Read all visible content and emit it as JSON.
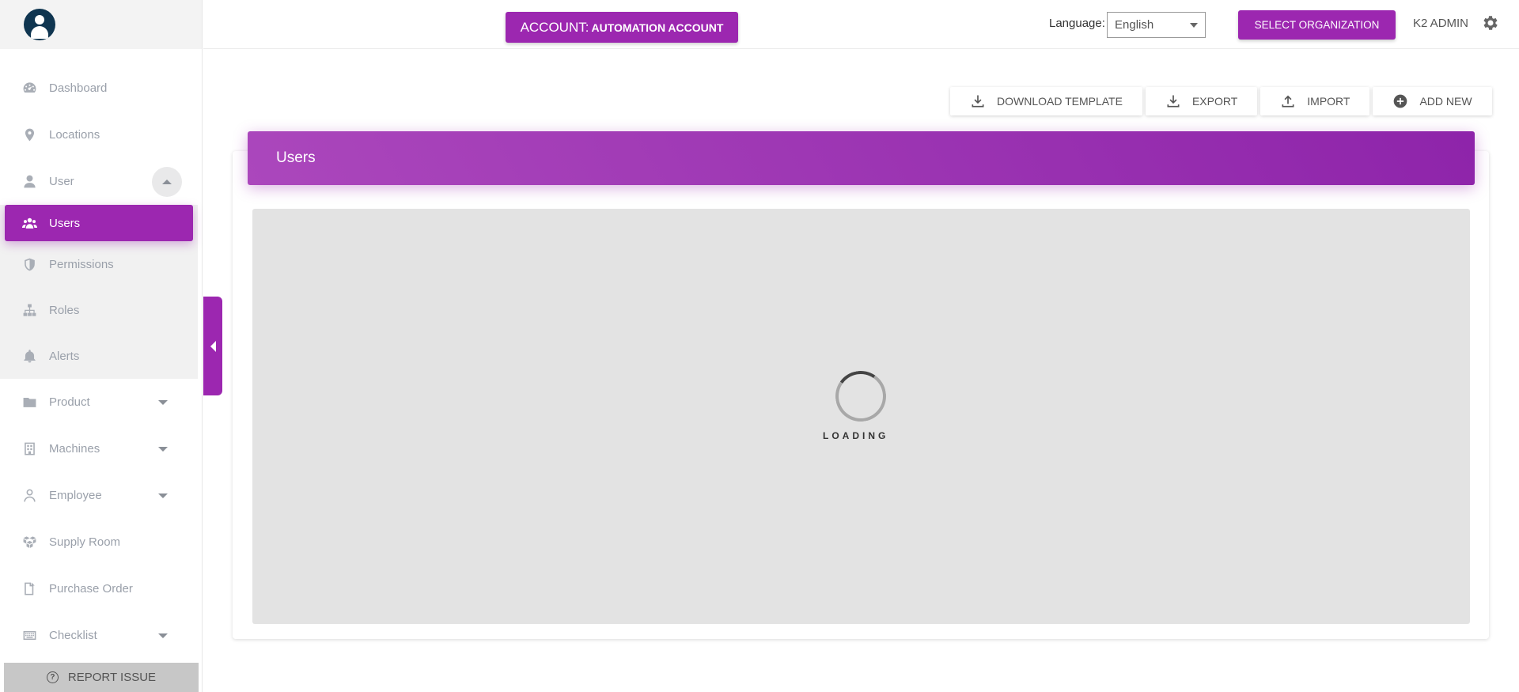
{
  "sidebar": {
    "items": [
      {
        "label": "Dashboard",
        "icon": "dashboard-gauge-icon"
      },
      {
        "label": "Locations",
        "icon": "map-pin-icon"
      },
      {
        "label": "User",
        "icon": "person-icon"
      },
      {
        "label": "Users",
        "icon": "users-group-icon"
      },
      {
        "label": "Permissions",
        "icon": "shield-icon"
      },
      {
        "label": "Roles",
        "icon": "sitemap-icon"
      },
      {
        "label": "Alerts",
        "icon": "bell-icon"
      },
      {
        "label": "Product",
        "icon": "folder-icon"
      },
      {
        "label": "Machines",
        "icon": "building-icon"
      },
      {
        "label": "Employee",
        "icon": "person-outline-icon"
      },
      {
        "label": "Supply Room",
        "icon": "boxes-icon"
      },
      {
        "label": "Purchase Order",
        "icon": "documents-icon"
      },
      {
        "label": "Checklist",
        "icon": "keyboard-icon"
      }
    ],
    "report_issue": "REPORT ISSUE"
  },
  "topbar": {
    "account_prefix": "ACCOUNT:",
    "account_name": "AUTOMATION ACCOUNT",
    "language_label": "Language:",
    "language_value": "English",
    "select_org": "SELECT ORGANIZATION",
    "user": "K2 ADMIN"
  },
  "actions": {
    "download_template": "DOWNLOAD TEMPLATE",
    "export": "EXPORT",
    "import": "IMPORT",
    "add_new": "ADD NEW"
  },
  "main": {
    "title": "Users",
    "loading": "LOADING"
  },
  "colors": {
    "accent": "#9c27b0",
    "sidebar_bg": "#ffffff",
    "loader_bg": "#e3e3e3"
  }
}
